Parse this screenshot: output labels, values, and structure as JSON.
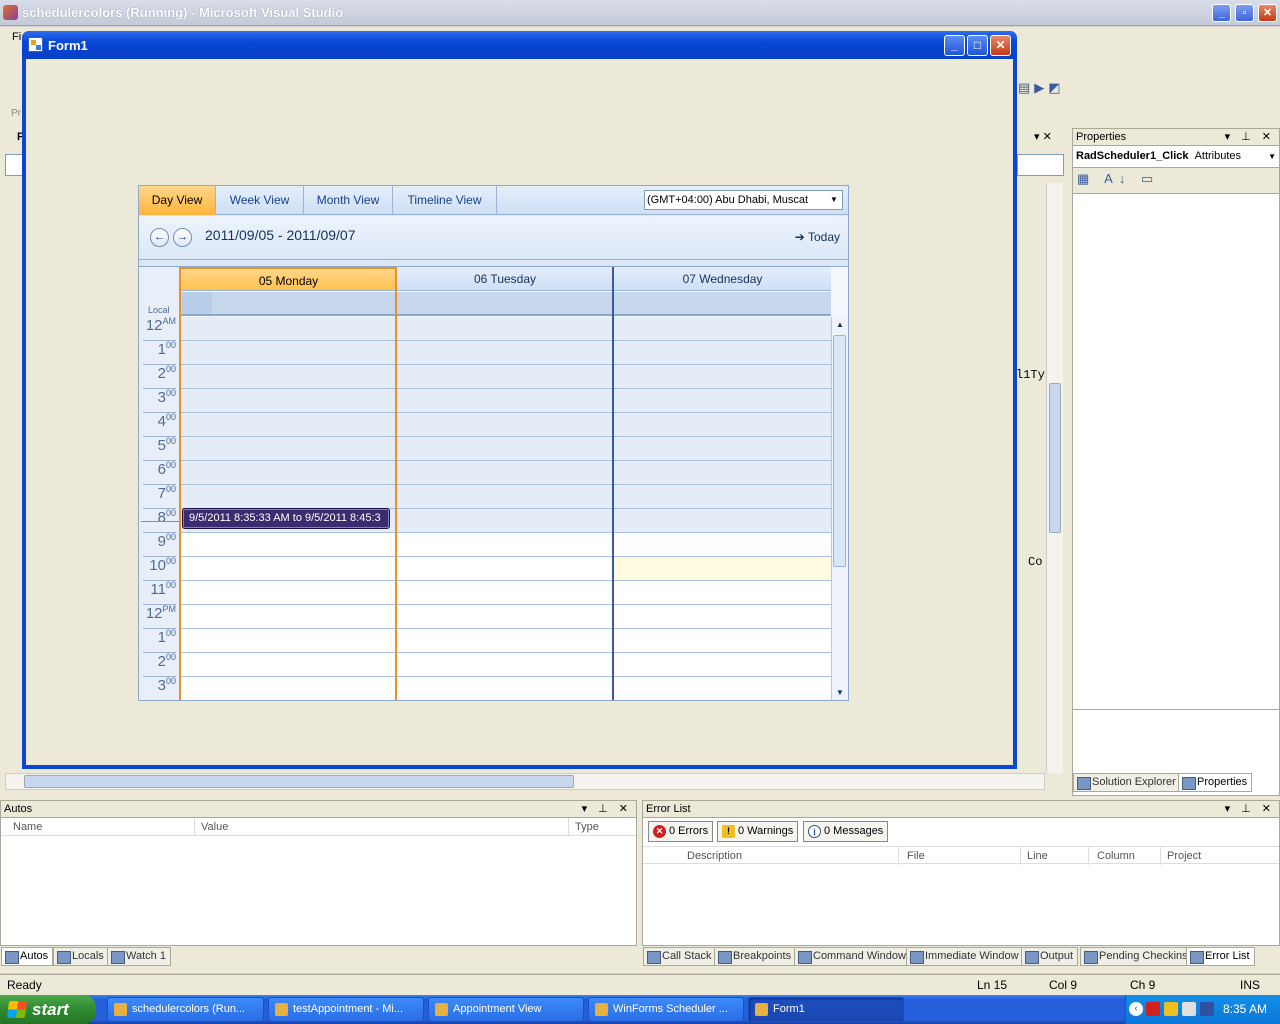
{
  "vs": {
    "title": "schedulercolors (Running) - Microsoft Visual Studio",
    "menu_first": "Fi",
    "code_fragment_1": "l1Ty",
    "code_fragment_2": "Co",
    "side_tab": "F",
    "side_tab2": "Pr"
  },
  "form": {
    "title": "Form1"
  },
  "scheduler": {
    "tabs": [
      "Day View",
      "Week View",
      "Month View",
      "Timeline View"
    ],
    "active_tab": 0,
    "timezone": "(GMT+04:00) Abu Dhabi, Muscat",
    "range": "2011/09/05 - 2011/09/07",
    "today_label": "Today",
    "local_label": "Local",
    "days": [
      "05 Monday",
      "06 Tuesday",
      "07 Wednesday"
    ],
    "hours": [
      {
        "h": "12",
        "s": "AM"
      },
      {
        "h": "1",
        "s": "00"
      },
      {
        "h": "2",
        "s": "00"
      },
      {
        "h": "3",
        "s": "00"
      },
      {
        "h": "4",
        "s": "00"
      },
      {
        "h": "5",
        "s": "00"
      },
      {
        "h": "6",
        "s": "00"
      },
      {
        "h": "7",
        "s": "00"
      },
      {
        "h": "8",
        "s": "00"
      },
      {
        "h": "9",
        "s": "00"
      },
      {
        "h": "10",
        "s": "00"
      },
      {
        "h": "11",
        "s": "00"
      },
      {
        "h": "12",
        "s": "PM"
      },
      {
        "h": "1",
        "s": "00"
      },
      {
        "h": "2",
        "s": "00"
      },
      {
        "h": "3",
        "s": "00"
      }
    ],
    "appointment": "9/5/2011 8:35:33 AM to 9/5/2011 8:45:3",
    "colors": {
      "today_border": "#e8902a",
      "appointment": "#3a2c6e",
      "header": "#cfdff5"
    }
  },
  "properties": {
    "title": "Properties",
    "object": "RadScheduler1_Click",
    "object_type": "Attributes",
    "tabs": [
      "Solution Explorer",
      "Properties"
    ]
  },
  "autos": {
    "title": "Autos",
    "columns": [
      "Name",
      "Value",
      "Type"
    ],
    "tabs": [
      "Autos",
      "Locals",
      "Watch 1"
    ]
  },
  "errors": {
    "title": "Error List",
    "errors": "0 Errors",
    "warnings": "0 Warnings",
    "messages": "0 Messages",
    "columns": [
      "Description",
      "File",
      "Line",
      "Column",
      "Project"
    ],
    "tabs": [
      "Call Stack",
      "Breakpoints",
      "Command Window",
      "Immediate Window",
      "Output",
      "Pending Checkins",
      "Error List"
    ]
  },
  "status": {
    "ready": "Ready",
    "ln": "Ln 15",
    "col": "Col 9",
    "ch": "Ch 9",
    "ins": "INS"
  },
  "taskbar": {
    "start": "start",
    "tasks": [
      "schedulercolors (Run...",
      "testAppointment - Mi...",
      "Appointment View",
      "WinForms Scheduler ...",
      "Form1"
    ],
    "clock": "8:35 AM"
  }
}
